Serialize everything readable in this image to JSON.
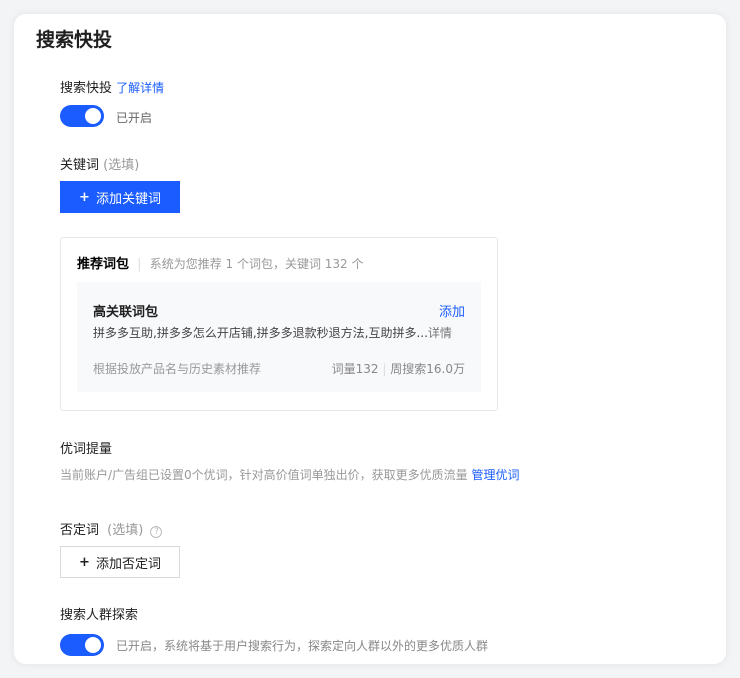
{
  "title": "搜索快投",
  "quick": {
    "label": "搜索快投",
    "link": "了解详情",
    "toggle_text": "已开启"
  },
  "keywords": {
    "label": "关键词",
    "optional": "(选填)",
    "add_button": "添加关键词"
  },
  "recommend": {
    "title": "推荐词包",
    "desc": "系统为您推荐 1 个词包，关键词 132 个",
    "pack": {
      "name": "高关联词包",
      "add": "添加",
      "words": "拼多多互助,拼多多怎么开店铺,拼多多退款秒退方法,互助拼多...",
      "detail": "详情",
      "source": "根据投放产品名与历史素材推荐",
      "count": "词量132",
      "weekly": "周搜索16.0万"
    }
  },
  "boost": {
    "label": "优词提量",
    "desc": "当前账户/广告组已设置0个优词，针对高价值词单独出价，获取更多优质流量",
    "link": "管理优词"
  },
  "negative": {
    "label": "否定词",
    "optional": "(选填)",
    "add_button": "添加否定词"
  },
  "crowd": {
    "label": "搜索人群探索",
    "toggle_text": "已开启，系统将基于用户搜索行为，探索定向人群以外的更多优质人群"
  }
}
